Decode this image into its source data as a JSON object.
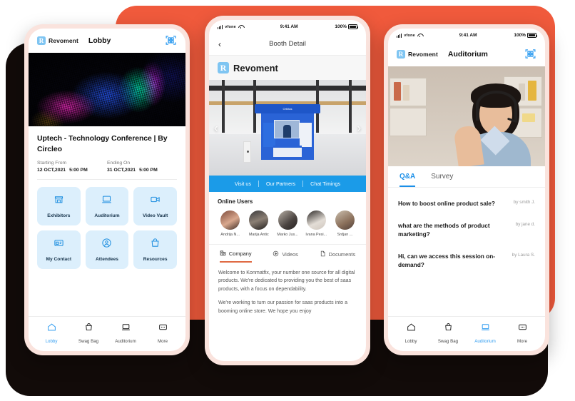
{
  "background": {
    "dark_color": "#120b09",
    "accent_color": "#F05A3C",
    "bezel_color": "#FAE3DD"
  },
  "brand": {
    "name": "Revoment",
    "mark_letter": "R",
    "mark_color": "#7FC5F2"
  },
  "status_bar": {
    "carrier": "vfone",
    "time": "9:41 AM",
    "battery": "100%",
    "battery_prefix": "⚡"
  },
  "phone_left": {
    "header": {
      "brand": "Revoment",
      "title": "Lobby",
      "qr_icon": "qr-scan-icon"
    },
    "hero": {
      "alt": "led-light-hero-image"
    },
    "event": {
      "title": "Uptech - Technology Conference | By Circleo",
      "start_label": "Starting From",
      "start_date": "12 OCT,2021",
      "start_time": "5:00 PM",
      "end_label": "Ending On",
      "end_date": "31 OCT,2021",
      "end_time": "5:00 PM"
    },
    "tiles": [
      {
        "label": "Exhibitors",
        "icon": "store-icon"
      },
      {
        "label": "Auditorium",
        "icon": "laptop-icon"
      },
      {
        "label": "Video Vault",
        "icon": "video-camera-icon"
      },
      {
        "label": "My Contact",
        "icon": "contact-card-icon"
      },
      {
        "label": "Attendees",
        "icon": "user-circle-icon"
      },
      {
        "label": "Resources",
        "icon": "bag-icon"
      }
    ],
    "tabbar": [
      {
        "label": "Lobby",
        "icon": "home-icon",
        "active": true
      },
      {
        "label": "Swag Bag",
        "icon": "bag-icon",
        "active": false
      },
      {
        "label": "Auditorium",
        "icon": "laptop-icon",
        "active": false
      },
      {
        "label": "More",
        "icon": "more-icon",
        "active": false
      }
    ]
  },
  "phone_mid": {
    "nav": {
      "back_icon": "chevron-left-icon",
      "title": "Booth Detail"
    },
    "booth_brand": {
      "name": "Revoment",
      "mark_letter": "R"
    },
    "booth_image": {
      "alt": "exhibition-booth-image",
      "sign": "Orbitas",
      "prev_icon": "chevron-left-icon",
      "next_icon": "chevron-right-icon"
    },
    "actions": [
      "Visit us",
      "Our Partners",
      "Chat Timings"
    ],
    "online": {
      "title": "Online Users",
      "users": [
        {
          "name": "Andrija N..."
        },
        {
          "name": "Marija Antic"
        },
        {
          "name": "Marko Jus..."
        },
        {
          "name": "Ivana Pesi..."
        },
        {
          "name": "Srdjan ..."
        }
      ]
    },
    "subtabs": [
      {
        "label": "Company",
        "icon": "company-icon",
        "active": true
      },
      {
        "label": "Videos",
        "icon": "play-icon",
        "active": false
      },
      {
        "label": "Documents",
        "icon": "document-icon",
        "active": false
      }
    ],
    "paragraphs": [
      "Welcome to Konmatfix, your number one source for all digital products. We're dedicated to providing you the best of saas products, with a focus on dependability.",
      "We're working to turn our passion for saas products into a booming online store. We hope you enjoy"
    ]
  },
  "phone_right": {
    "header": {
      "brand": "Revoment",
      "title": "Auditorium",
      "qr_icon": "qr-scan-icon"
    },
    "speaker_image": {
      "alt": "headset-speaker-image"
    },
    "tabs": [
      {
        "label": "Q&A",
        "active": true
      },
      {
        "label": "Survey",
        "active": false
      }
    ],
    "questions": [
      {
        "text": "How to boost online product sale?",
        "by": "by smith J."
      },
      {
        "text": "what are the methods of product marketing?",
        "by": "by jane d."
      },
      {
        "text": "Hi, can we access this session on-demand?",
        "by": "by Laura S."
      }
    ],
    "tabbar": [
      {
        "label": "Lobby",
        "icon": "home-icon",
        "active": false
      },
      {
        "label": "Swag Bag",
        "icon": "bag-icon",
        "active": false
      },
      {
        "label": "Auditorium",
        "icon": "laptop-icon",
        "active": true
      },
      {
        "label": "More",
        "icon": "more-icon",
        "active": false
      }
    ]
  }
}
